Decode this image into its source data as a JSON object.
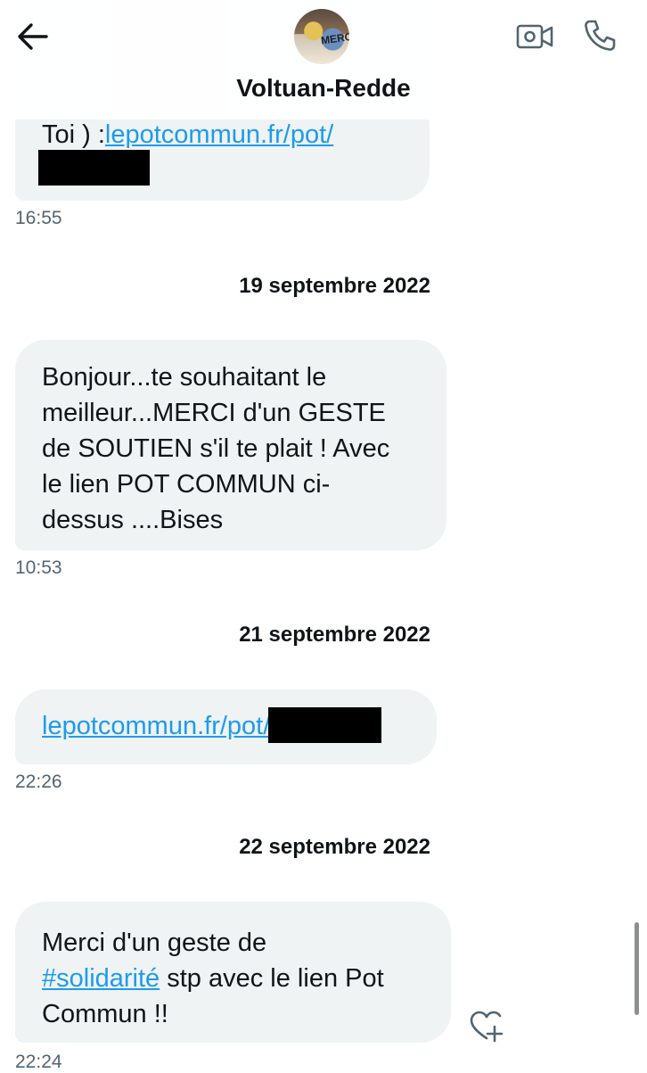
{
  "header": {
    "contact_name": "Voltuan-Redde",
    "avatar_text": "MERCI",
    "back_icon": "arrow-left-icon",
    "video_icon": "video-call-icon",
    "phone_icon": "phone-call-icon"
  },
  "messages": [
    {
      "text_prefix": "Toi ) :",
      "link": "lepotcommun.fr/pot/",
      "redacted": true,
      "time": "16:55"
    },
    {
      "date": "19 septembre 2022",
      "lines": [
        "Bonjour...te souhaitant le",
        "meilleur...MERCI d'un GESTE",
        "de SOUTIEN s'il te plait ! Avec",
        "le lien POT COMMUN ci-",
        "dessus ....Bises"
      ],
      "time": "10:53"
    },
    {
      "date": "21 septembre 2022",
      "link": "lepotcommun.fr/pot/",
      "redacted": true,
      "time": "22:26"
    },
    {
      "date": "22 septembre 2022",
      "line1": "Merci d'un geste de",
      "hashtag": "#solidarité",
      "line2_rest": " stp avec le lien Pot",
      "line3": "Commun !!",
      "time": "22:24"
    }
  ],
  "colors": {
    "bubble": "#eff3f4",
    "link": "#1d9bf0",
    "meta": "#536471",
    "text": "#0f1419"
  }
}
